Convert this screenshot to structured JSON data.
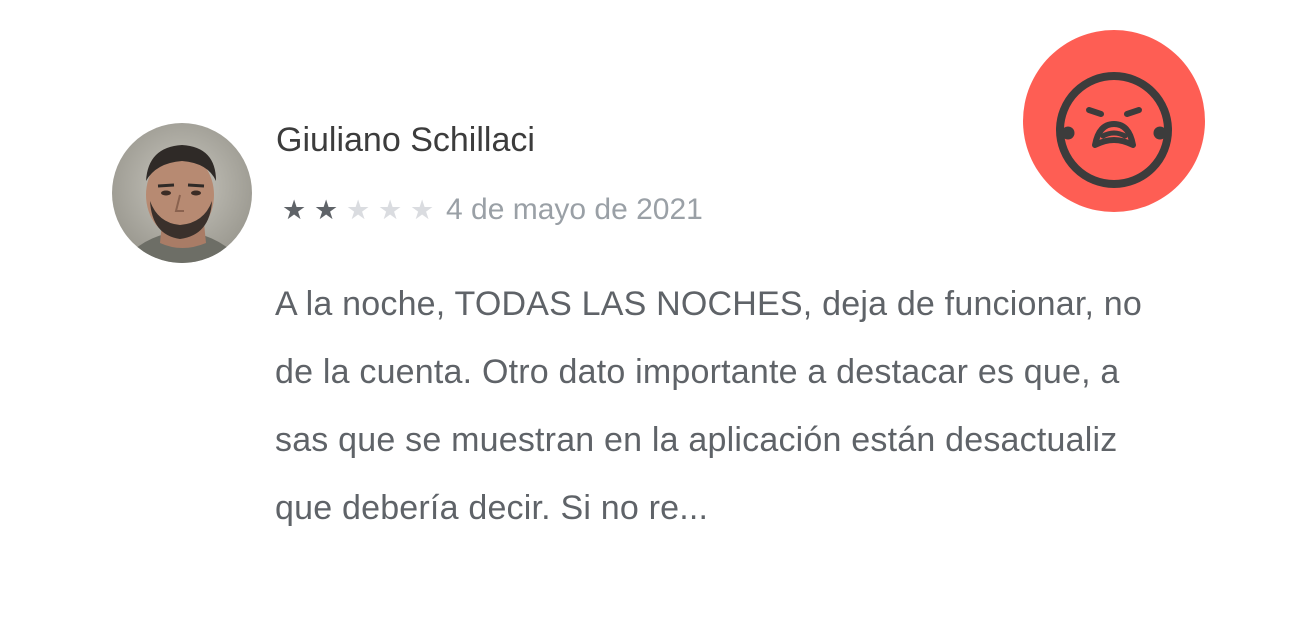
{
  "review": {
    "reviewer_name": "Giuliano Schillaci",
    "rating": 2,
    "max_rating": 5,
    "date": "4 de mayo de 2021",
    "text_lines": [
      "A la noche, TODAS LAS NOCHES, deja de funcionar, no",
      "de la cuenta. Otro dato importante a destacar es que, a",
      "sas que se muestran en la aplicación están desactualiz",
      "que debería decir. Si no re..."
    ]
  },
  "sentiment": {
    "icon": "sad-face-icon",
    "color": "#fe5e54"
  },
  "colors": {
    "star_filled": "#5f6368",
    "star_empty": "#dadce0",
    "name_text": "#3c3c3c",
    "body_text": "#5f6368",
    "date_text": "#9aa0a6"
  },
  "icons": {
    "avatar": "avatar",
    "star": "star-icon"
  }
}
